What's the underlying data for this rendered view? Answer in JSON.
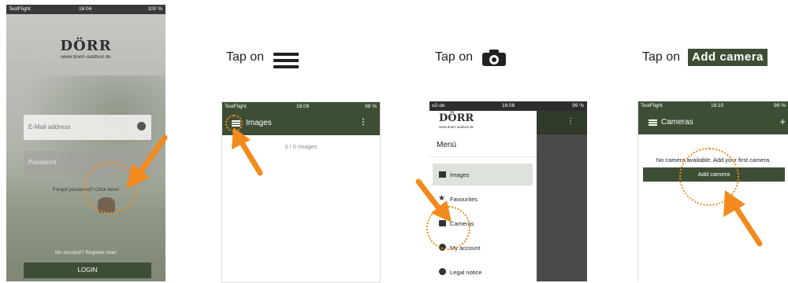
{
  "colors": {
    "accent": "#f28a1e",
    "app_green": "#3e4e34",
    "status_white": "#ffffff"
  },
  "login": {
    "status": {
      "carrier": "TestFlight",
      "time": "16:04",
      "battery": "100 %"
    },
    "brand": "DÖRR",
    "url": "www.doerr-outdoor.de",
    "email_placeholder": "E-Mail address",
    "password_placeholder": "Password",
    "forgot": "Forgot password? Click here!",
    "register": "No account? Register now!",
    "login_button": "LOGIN"
  },
  "step1": {
    "tap_text": "Tap on",
    "icon": "hamburger-menu-icon",
    "status": {
      "carrier": "TestFlight",
      "time": "16:09",
      "battery": "99 %"
    },
    "title": "Images",
    "count": "0 / 0 Images"
  },
  "step2": {
    "tap_text": "Tap on",
    "icon": "camera-icon",
    "status": {
      "carrier": "o2-de",
      "time": "16:08",
      "battery": "99 %"
    },
    "brand": "DÖRR",
    "url": "www.doerr-outdoor.de",
    "menu_title": "Menü",
    "items": [
      {
        "label": "Images",
        "icon": "image-icon"
      },
      {
        "label": "Favourites",
        "icon": "star-icon"
      },
      {
        "label": "Cameras",
        "icon": "camera-icon"
      },
      {
        "label": "My account",
        "icon": "account-icon"
      },
      {
        "label": "Legal notice",
        "icon": "info-icon"
      }
    ]
  },
  "step3": {
    "tap_text": "Tap on",
    "highlight": "Add camera",
    "status": {
      "carrier": "TestFlight",
      "time": "16:10",
      "battery": "99 %"
    },
    "title": "Cameras",
    "message": "No camera available. Add your first camera.",
    "button": "Add camera"
  }
}
